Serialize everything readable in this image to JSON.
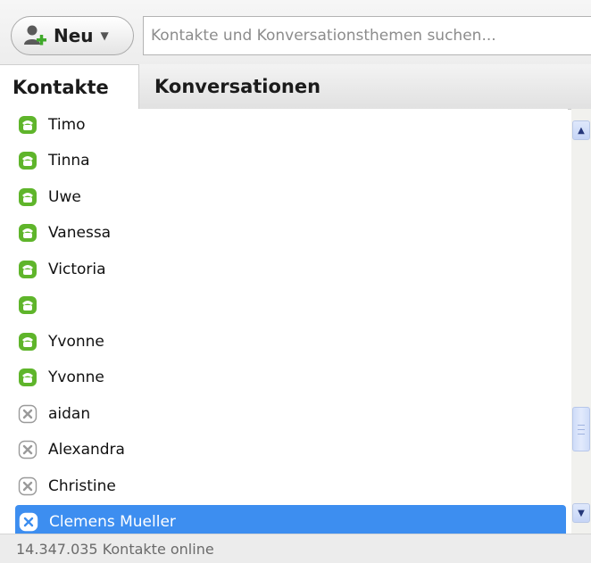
{
  "toolbar": {
    "new_button_label": "Neu",
    "new_button_icon": "add-contact-icon",
    "dropdown_icon": "chevron-down-icon",
    "search_placeholder": "Kontakte und Konversationsthemen suchen..."
  },
  "tabs": [
    {
      "label": "Kontakte",
      "active": true
    },
    {
      "label": "Konversationen",
      "active": false
    }
  ],
  "contacts": [
    {
      "name": "Timo",
      "status": "online"
    },
    {
      "name": "Tinna",
      "status": "online"
    },
    {
      "name": "Uwe",
      "status": "online"
    },
    {
      "name": "Vanessa",
      "status": "online"
    },
    {
      "name": "Victoria",
      "status": "online"
    },
    {
      "name": "",
      "status": "online"
    },
    {
      "name": "Yvonne",
      "status": "online"
    },
    {
      "name": "Yvonne",
      "status": "online"
    },
    {
      "name": "aidan",
      "status": "offline"
    },
    {
      "name": "Alexandra",
      "status": "offline"
    },
    {
      "name": "Christine",
      "status": "offline"
    },
    {
      "name": "Clemens Mueller",
      "status": "offline",
      "selected": true
    }
  ],
  "colors": {
    "online": "#5fb52b",
    "offline": "#9a9a9a",
    "selection": "#3d8ef0"
  },
  "status_bar": {
    "text": "14.347.035 Kontakte online"
  }
}
